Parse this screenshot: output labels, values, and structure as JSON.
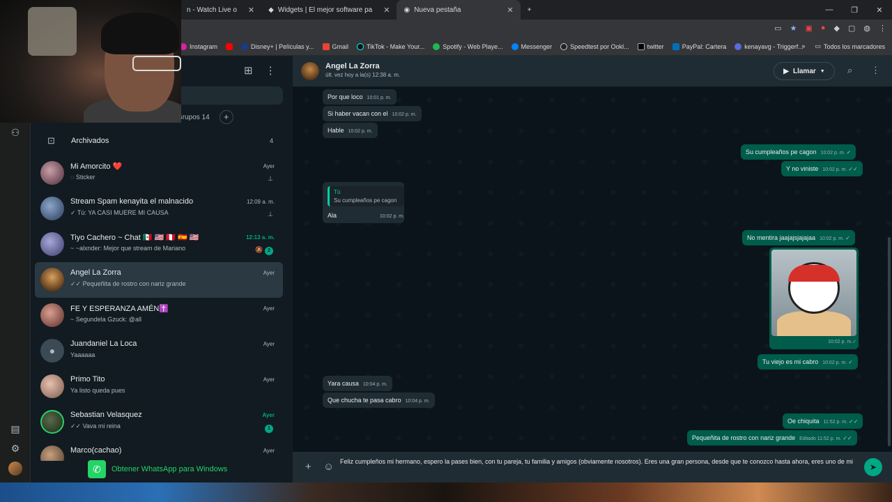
{
  "browser": {
    "tabs": [
      {
        "label": "n - Watch Live o",
        "active": false
      },
      {
        "label": "Widgets | El mejor software pa",
        "active": false
      },
      {
        "label": "Nueva pestaña",
        "active": true
      }
    ],
    "bookmarks": [
      "Instagram",
      "Disney+ | Películas y...",
      "Gmail",
      "TikTok - Make Your...",
      "Spotify - Web Playe...",
      "Messenger",
      "Speedtest por Ookl...",
      "twitter",
      "PayPal: Cartera",
      "kenayavg - Triggerf..."
    ],
    "all_bookmarks": "Todos los marcadores"
  },
  "sidebar": {
    "chips_label": "Grupos 14",
    "archived_label": "Archivados",
    "archived_count": "4",
    "chats": [
      {
        "name": "Mi Amorcito ❤️",
        "preview": "Sticker",
        "time": "Ayer",
        "meta": "pin",
        "avatar": "#6a4a5a"
      },
      {
        "name": "Stream Spam kenayita el malnacido",
        "preview": "✓ Tú: YA CASI MUERE MI CAUSA",
        "time": "12:09 a. m.",
        "meta": "pin",
        "avatar": "#4a6a8a"
      },
      {
        "name": "Tiyo Cachero ~ Chat 🇲🇽 🇺🇸 🇵🇪 🇪🇸 🇺🇸",
        "preview": "~ ~alxnder: Mejor que stream de Mariano",
        "time": "12:13 a. m.",
        "time_green": true,
        "meta": "2",
        "avatar": "#5a5a7a"
      },
      {
        "name": "Angel La Zorra",
        "preview": "✓✓ Pequeñita de rostro con nariz grande",
        "time": "Ayer",
        "active": true,
        "avatar": "#b88040"
      },
      {
        "name": "FE Y ESPERANZA AMÉN✝️",
        "preview": "~ Segundela Gzuck: @all",
        "time": "Ayer",
        "avatar": "#8a5a4a"
      },
      {
        "name": "Juandaniel La Loca",
        "preview": "Yaaaaaa",
        "time": "Ayer",
        "avatar": "#3b4a54"
      },
      {
        "name": "Primo Tito",
        "preview": "Ya listo queda pues",
        "time": "Ayer",
        "avatar": "#9a7a6a"
      },
      {
        "name": "Sebastian Velasquez",
        "preview": "✓✓ Vava mi reina",
        "time": "Ayer",
        "time_green": true,
        "meta": "1",
        "avatar": "#2a3a2a"
      },
      {
        "name": "Marco(cachao)",
        "preview": "",
        "time": "Ayer",
        "avatar": "#7a6a5a"
      }
    ],
    "get_whatsapp": "Obtener WhatsApp para Windows"
  },
  "conversation": {
    "contact_name": "Angel La Zorra",
    "status": "últ. vez hoy a la(s) 12:38 a. m.",
    "call_label": "Llamar",
    "messages": [
      {
        "text": "Por que loco",
        "time": "10:01 p. m."
      },
      {
        "text": "Si haber vacan con el",
        "time": "10:02 p. m."
      },
      {
        "text": "Hable",
        "time": "10:02 p. m."
      },
      {
        "text": "Su cumpleaños pe cagon",
        "time": "10:02 p. m."
      },
      {
        "text": "Y no viniste",
        "time": "10:02 p. m."
      },
      {
        "quote_author": "Tú",
        "quote_text": "Su cumpleaños pe cagon",
        "text": "Ala",
        "time": "10:02 p. m."
      },
      {
        "text": "No mentira jaajajsjajajaa",
        "time": "10:02 p. m."
      },
      {
        "text": "",
        "time": "10:02 p. m."
      },
      {
        "text": "Tu viejo es mi cabro",
        "time": "10:02 p. m."
      },
      {
        "text": "Yara causa",
        "time": "10:04 p. m."
      },
      {
        "text": "Que chucha te pasa cabro",
        "time": "10:04 p. m."
      },
      {
        "text": "Oe chiquita",
        "time": "11:52 p. m."
      },
      {
        "text": "Pequeñita de rostro con nariz grande",
        "time": "Editado 11:52 p. m."
      }
    ],
    "composer_text": "Feliz cumpleños mi hermano, espero la pases bien, con tu pareja, tu familia y amigos (obviamente nosotros). Eres una gran persona, desde que te conozco hasta ahora, eres uno de mi"
  }
}
